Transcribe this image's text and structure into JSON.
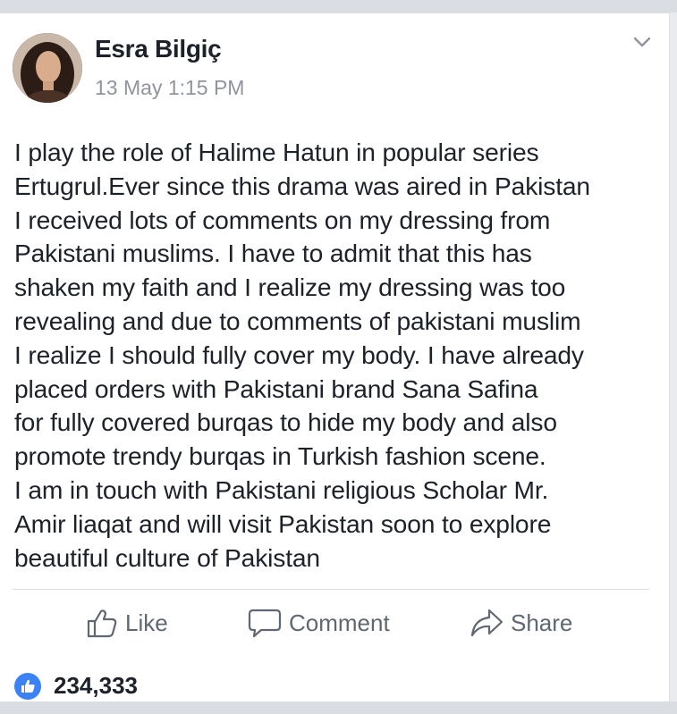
{
  "post": {
    "author": "Esra Bilgiç",
    "timestamp": "13 May 1:15 PM",
    "text": "I play the role of Halime Hatun in popular series\nErtugrul.Ever since this drama was aired in Pakistan\nI received lots of comments on my dressing from\nPakistani muslims. I have to admit that this has\nshaken my faith and I realize my dressing was too\nrevealing and due to comments of pakistani muslim\nI realize I should fully cover my body.  I have already\nplaced orders with Pakistani brand Sana Safina\nfor fully covered burqas  to hide my body and also\npromote trendy burqas in Turkish fashion scene.\nI am in touch with Pakistani religious Scholar Mr.\nAmir liaqat and will visit Pakistan soon to explore\nbeautiful culture of Pakistan",
    "menu_icon": "chevron-down-icon",
    "avatar_icon": "profile-photo"
  },
  "actions": {
    "like_label": "Like",
    "comment_label": "Comment",
    "share_label": "Share"
  },
  "reactions": {
    "count": "234,333",
    "icon": "thumbs-up-icon"
  },
  "colors": {
    "text": "#1d2129",
    "secondary": "#90949c",
    "action": "#606770",
    "like_blue": "#3b82f6",
    "background": "#e9ebee"
  }
}
